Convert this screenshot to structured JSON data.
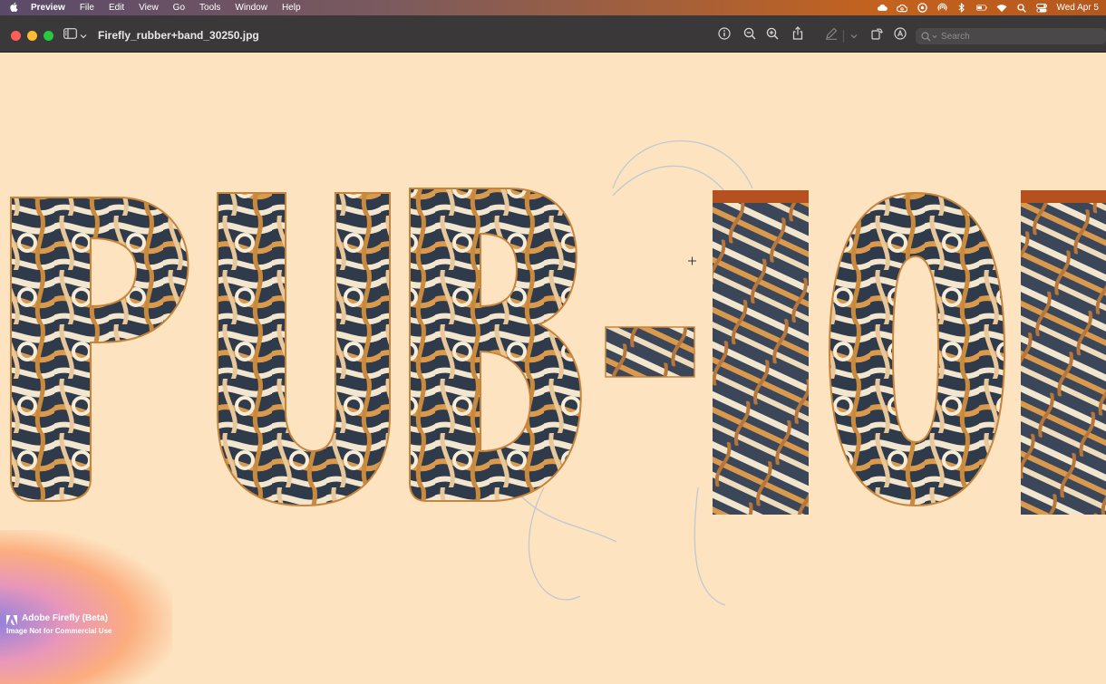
{
  "menubar": {
    "items": [
      "Preview",
      "File",
      "Edit",
      "View",
      "Go",
      "Tools",
      "Window",
      "Help"
    ],
    "clock": "Wed Apr 5"
  },
  "window": {
    "title": "Firefly_rubber+band_30250.jpg"
  },
  "search": {
    "placeholder": "Search"
  },
  "watermark": {
    "title": "Adobe Firefly (Beta)",
    "subtitle": "Image Not for Commercial Use"
  },
  "colors": {
    "canvas_bg": "#fde3c0",
    "toolbar_bg": "#3a3838",
    "band_light": "#f3e6cf",
    "band_orange": "#d99a4e",
    "band_dark": "#2f3a4a",
    "band_rust": "#b5511f"
  },
  "icons": [
    "apple-icon",
    "cloud-icon",
    "creative-cloud-icon",
    "target-icon",
    "airdrop-icon",
    "bluetooth-icon",
    "battery-icon",
    "wifi-icon",
    "search-icon",
    "control-center-icon",
    "sidebar-toggle-icon",
    "chevron-down-icon",
    "info-icon",
    "zoom-out-icon",
    "zoom-in-icon",
    "share-icon",
    "markup-pen-icon",
    "rotate-icon",
    "highlight-icon"
  ]
}
